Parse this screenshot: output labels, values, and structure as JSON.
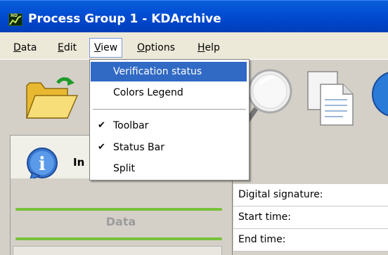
{
  "window": {
    "title": "Process Group 1 - KDArchive",
    "icon_text": "ND"
  },
  "menubar": {
    "items": [
      {
        "label": "Data",
        "hotkey_index": 0
      },
      {
        "label": "Edit",
        "hotkey_index": 0
      },
      {
        "label": "View",
        "hotkey_index": 0
      },
      {
        "label": "Options",
        "hotkey_index": 0
      },
      {
        "label": "Help",
        "hotkey_index": 0
      }
    ],
    "open_menu": "View"
  },
  "view_menu": {
    "items": [
      {
        "label": "Verification status",
        "checked": false,
        "selected": true
      },
      {
        "label": "Colors Legend",
        "checked": false,
        "selected": false
      },
      {
        "label": "Toolbar",
        "checked": true,
        "selected": false
      },
      {
        "label": "Status Bar",
        "checked": true,
        "selected": false
      },
      {
        "label": "Split",
        "checked": false,
        "selected": false
      }
    ]
  },
  "left_panel": {
    "info_tab_label": "In",
    "data_section_label": "Data"
  },
  "right_panel": {
    "fields": [
      {
        "label": "Digital signature:"
      },
      {
        "label": "Start time:"
      },
      {
        "label": "End time:"
      }
    ]
  },
  "colors": {
    "title_bar": "#0352d6",
    "menu_selection": "#316ac5",
    "accent_green": "#77c23a"
  },
  "icons": [
    "open-folder-icon",
    "magnifier-icon",
    "documents-icon",
    "globe-icon",
    "info-icon",
    "check-icon"
  ]
}
